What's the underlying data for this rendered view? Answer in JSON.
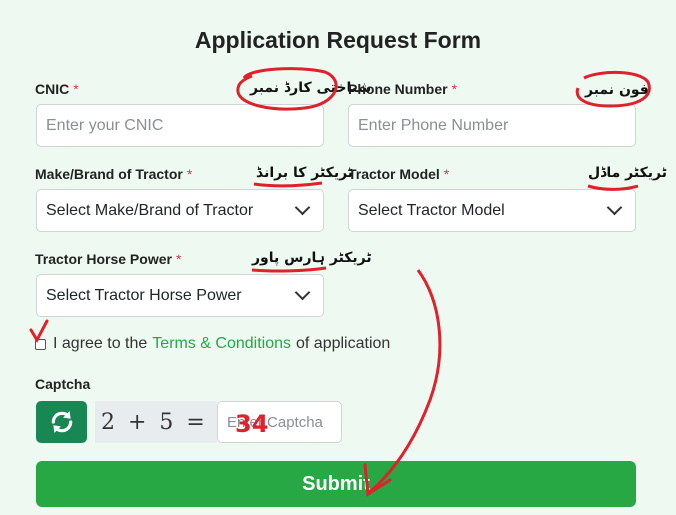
{
  "form": {
    "title": "Application Request Form",
    "required_mark": "*",
    "cnic": {
      "label": "CNIC",
      "urdu_label": "شناختی کارڈ نمبر",
      "placeholder": "Enter your CNIC",
      "value": ""
    },
    "phone": {
      "label": "Phone Number",
      "urdu_label": "فون نمبر",
      "placeholder": "Enter Phone Number",
      "value": ""
    },
    "make": {
      "label": "Make/Brand of Tractor",
      "urdu_label": "ٹریکٹر کا برانڈ",
      "selected": "Select Make/Brand of Tractor"
    },
    "model": {
      "label": "Tractor Model",
      "urdu_label": "ٹریکٹر ماڈل",
      "selected": "Select Tractor Model"
    },
    "horsepower": {
      "label": "Tractor Horse Power",
      "urdu_label": "ٹریکٹر ہارس پاور",
      "selected": "Select Tractor Horse Power"
    },
    "agree": {
      "prefix": "I agree to the",
      "link": "Terms & Conditions",
      "suffix": "of application",
      "checked": false
    },
    "captcha": {
      "label": "Captcha",
      "challenge": "2 + 5 =",
      "placeholder": "Enter Captcha",
      "handwritten_answer": "34"
    },
    "submit_label": "Submit"
  },
  "colors": {
    "background": "#eefaf1",
    "accent_green": "#28a745",
    "refresh_green": "#198754",
    "required_red": "#dc3545",
    "annotation_red": "#e0202a"
  },
  "icons": {
    "refresh": "refresh-icon",
    "dropdown": "chevron-down-icon"
  }
}
